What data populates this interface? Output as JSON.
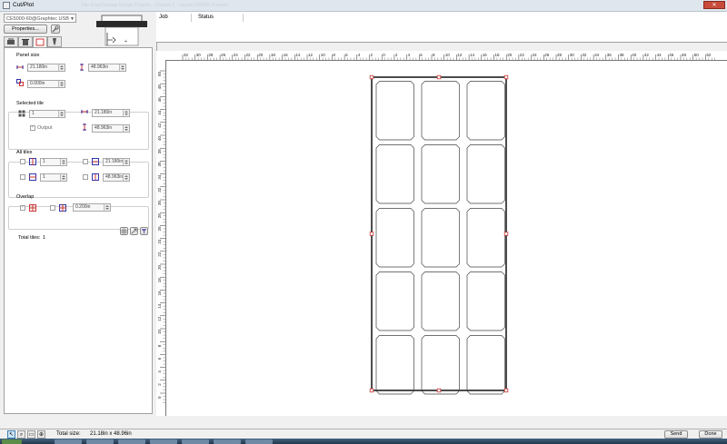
{
  "window": {
    "title": "Cut/Plot",
    "background_title": "File Eula/Cleanup Design Projects · Chapter 1 · Layout CE5000 Preview",
    "close_label": "✕"
  },
  "device": {
    "selected": "CE5000-60@Graphtec USB",
    "properties_label": "Properties..."
  },
  "tabs": [
    {
      "name": "cut-tab",
      "active": false
    },
    {
      "name": "weed-tab",
      "active": false
    },
    {
      "name": "panel-tab",
      "active": true
    },
    {
      "name": "blade-tab",
      "active": false
    }
  ],
  "panel_size": {
    "title": "Panel size",
    "width": "21.180in",
    "height": "48.963in",
    "overlap": "0.000in"
  },
  "selected_tile": {
    "title": "Selected tile",
    "tile": "1",
    "width": "21.180in",
    "height": "48.963in",
    "output_label": "Output"
  },
  "all_tiles": {
    "title": "All tiles",
    "cols": "1",
    "rows": "1",
    "width": "21.180in",
    "height": "48.963in"
  },
  "overlap": {
    "title": "Overlap",
    "value": "0.200in"
  },
  "total_tiles": {
    "label": "Total tiles:",
    "value": "1"
  },
  "job_list": {
    "columns": [
      "Job",
      "Status"
    ]
  },
  "ruler": {
    "h_labels": [
      "32",
      "30",
      "28",
      "26",
      "24",
      "22",
      "20",
      "18",
      "16",
      "14",
      "12",
      "10",
      "8",
      "6",
      "4",
      "2",
      "0",
      "2",
      "4",
      "6",
      "8",
      "10",
      "12",
      "14",
      "16",
      "18",
      "20",
      "22",
      "24",
      "26",
      "28",
      "30",
      "32",
      "34",
      "36",
      "38",
      "40",
      "42",
      "44",
      "46",
      "48",
      "50",
      "52"
    ],
    "v_labels": [
      "50",
      "48",
      "46",
      "44",
      "42",
      "40",
      "38",
      "36",
      "34",
      "32",
      "30",
      "28",
      "26",
      "24",
      "22",
      "20",
      "18",
      "16",
      "14",
      "12",
      "10",
      "8",
      "6",
      "4",
      "2",
      "0"
    ]
  },
  "status": {
    "total_size_label": "Total size:",
    "total_size_value": "21.18in x 48.96in",
    "send_label": "Send",
    "done_label": "Done"
  },
  "colors": {
    "handle": "#cc3333",
    "card_stroke": "#444444",
    "taskbar": "#2d4760"
  },
  "cards": {
    "columns": 3,
    "rows": 5
  }
}
